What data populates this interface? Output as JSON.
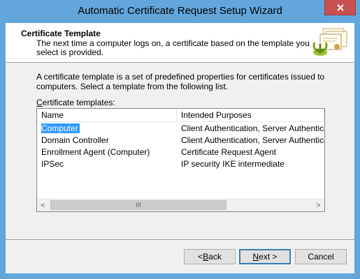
{
  "window": {
    "title": "Automatic Certificate Request Setup Wizard",
    "close_symbol": "✕"
  },
  "header": {
    "title": "Certificate Template",
    "description": "The next time a computer logs on, a certificate based on the template you select is provided.",
    "icon": "certificate-wizard-icon"
  },
  "intro": "A certificate template is a set of predefined properties for certificates issued to computers. Select a template from the following list.",
  "list": {
    "label_prefix": "",
    "label_accel": "C",
    "label_rest": "ertificate templates:",
    "columns": [
      "Name",
      "Intended Purposes"
    ],
    "rows": [
      {
        "name": "Computer",
        "purposes": "Client Authentication, Server Authentication",
        "selected": true
      },
      {
        "name": "Domain Controller",
        "purposes": "Client Authentication, Server Authentication",
        "selected": false
      },
      {
        "name": "Enrollment Agent (Computer)",
        "purposes": "Certificate Request Agent",
        "selected": false
      },
      {
        "name": "IPSec",
        "purposes": "IP security IKE intermediate",
        "selected": false
      }
    ],
    "scroll_left": "<",
    "scroll_right": ">",
    "scroll_thumb": "III"
  },
  "buttons": {
    "back_prefix": "< ",
    "back_accel": "B",
    "back_rest": "ack",
    "next_accel": "N",
    "next_rest": "ext >",
    "cancel": "Cancel"
  },
  "colors": {
    "selection": "#3399ff",
    "title_bar": "#62a6dc",
    "close_button": "#c75050"
  }
}
